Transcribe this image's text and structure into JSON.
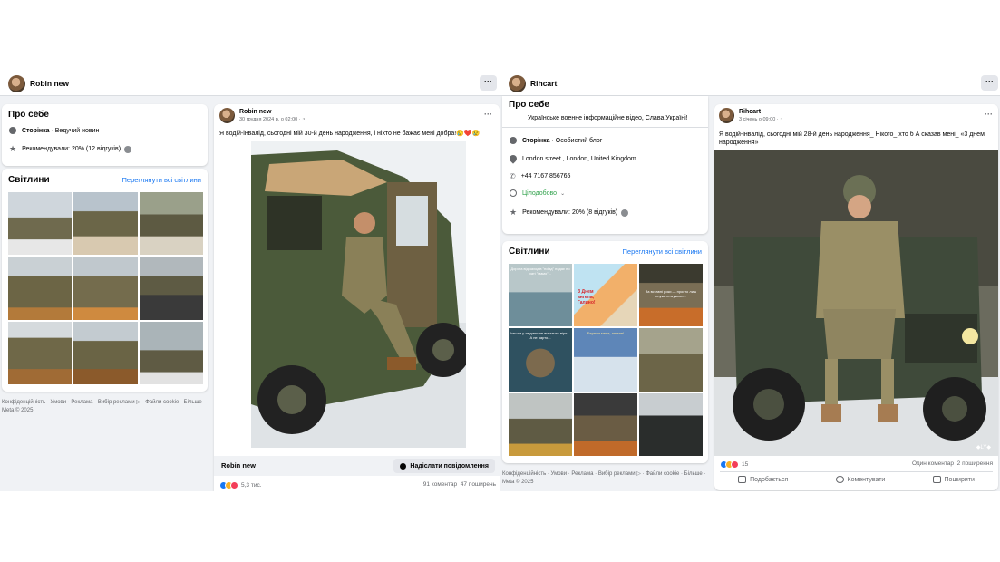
{
  "left": {
    "topbar": {
      "name": "Robin new"
    },
    "about": {
      "title": "Про себе",
      "page_label": "Сторінка",
      "page_category": "Ведучий новин",
      "recommend": "Рекомендували: 20% (12 відгуків)"
    },
    "photos": {
      "title": "Світлини",
      "see_all": "Переглянути всі світлини"
    },
    "footer": {
      "links": "Конфіденційність · Умови · Реклама · Вибір реклами ▷ · Файли cookie · Більше ·",
      "meta": "Meta © 2025"
    },
    "post": {
      "author": "Robin new",
      "date": "30 грудня 2024 р. о 02:00 · ◔",
      "text": "Я водій-інвалід, сьогодні мій 30-й день народження, і ніхто не бажає мені добра!😢❤️😢",
      "footer_name": "Robin new",
      "message_button": "Надіслати повідомлення",
      "reactions": "5,3 тис.",
      "comments": "91 коментар",
      "shares": "47 поширень"
    }
  },
  "right": {
    "topbar": {
      "name": "Rihcart"
    },
    "about": {
      "title": "Про себе",
      "description": "Українське военне інформаційне відео, Слава Україні!",
      "page_label": "Сторінка",
      "page_category": "Особистий блог",
      "address": "London street , London, United Kingdom",
      "phone": "+44 7167 856765",
      "hours": "Цілодобово",
      "recommend": "Рекомендували: 20% (8 відгуків)"
    },
    "photos": {
      "title": "Світлини",
      "see_all": "Переглянути всі світлини",
      "captions": [
        "Дорога від заходів \"поїзд\" подає по хаті \"мамо\"...",
        "З Днем ангела, Галино!",
        "За вставні роки — просто лиш служити мужньо...",
        "Інколи у людини не вистачає віри... А не варто...",
        "Бережи мене, ангеле!",
        "",
        "",
        "",
        ""
      ]
    },
    "footer": {
      "links": "Конфіденційність · Умови · Реклама · Вибір реклами ▷ · Файли cookie · Більше ·",
      "meta": "Meta © 2025"
    },
    "post": {
      "author": "Rihcart",
      "date": "3 січень о 09:00 · ◔",
      "text": "Я водій-інвалід, сьогодні мій 28-й день народження_ Нікого_ хто б А сказав мені_ «3 днем народження»",
      "watermark": "◆LY◆",
      "reactions": "15",
      "comments": "Один коментар",
      "shares": "2 поширення",
      "like": "Подобається",
      "comment": "Коментувати",
      "share": "Поширити"
    }
  },
  "colors": {
    "accent": "#1877f2",
    "bg": "#f0f2f5",
    "green": "#31a24c"
  }
}
